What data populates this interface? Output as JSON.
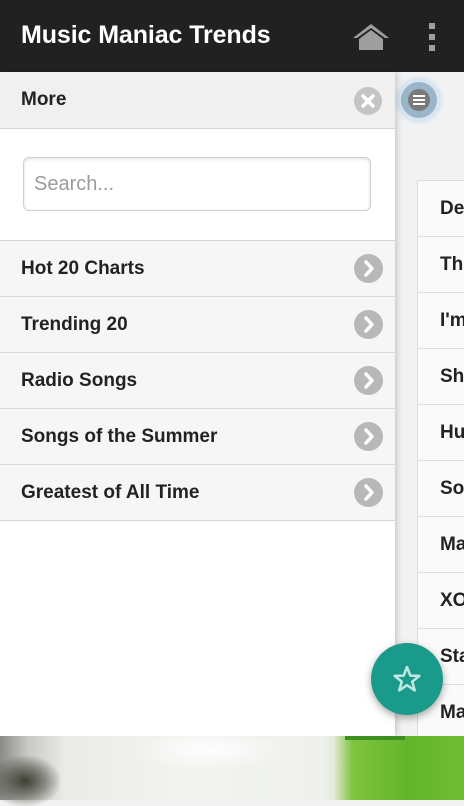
{
  "appbar": {
    "title": "Music Maniac Trends",
    "icons": [
      "home-icon",
      "overflow-menu-icon"
    ]
  },
  "drawer": {
    "title": "More",
    "close_icon": "close-icon",
    "search": {
      "placeholder": "Search...",
      "value": ""
    },
    "items": [
      {
        "label": "Hot 20 Charts",
        "icon": "chevron-right-icon"
      },
      {
        "label": "Trending 20",
        "icon": "chevron-right-icon"
      },
      {
        "label": "Radio Songs",
        "icon": "chevron-right-icon"
      },
      {
        "label": "Songs of the Summer",
        "icon": "chevron-right-icon"
      },
      {
        "label": "Greatest of All Time",
        "icon": "chevron-right-icon"
      }
    ]
  },
  "main": {
    "menu_toggle_icon": "list-menu-icon",
    "rows": [
      {
        "label": "De"
      },
      {
        "label": "Th"
      },
      {
        "label": "I'm"
      },
      {
        "label": "Sh"
      },
      {
        "label": "Hu"
      },
      {
        "label": "So"
      },
      {
        "label": "Ma"
      },
      {
        "label": "XO"
      },
      {
        "label": "Sta"
      },
      {
        "label": "Ma"
      }
    ]
  },
  "fab": {
    "icon": "star-icon"
  },
  "colors": {
    "appbar_bg": "#212121",
    "fab_bg": "#1a9a8a",
    "drawer_bg": "#ffffff",
    "accent_glow": "#b8d4ec"
  }
}
